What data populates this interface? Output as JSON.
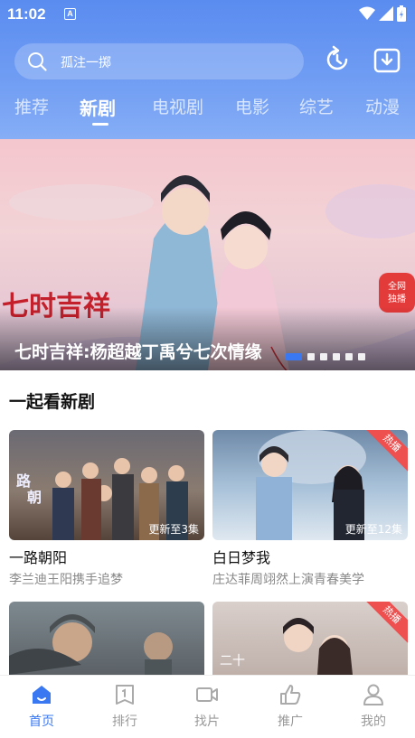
{
  "status_bar": {
    "time": "11:02",
    "notification_glyph": "A"
  },
  "search": {
    "placeholder": "孤注一掷"
  },
  "header_actions": [
    "history-icon",
    "download-icon"
  ],
  "tabs": [
    {
      "label": "推荐",
      "active": false
    },
    {
      "label": "新剧",
      "active": true
    },
    {
      "label": "电视剧",
      "active": false
    },
    {
      "label": "电影",
      "active": false
    },
    {
      "label": "综艺",
      "active": false
    },
    {
      "label": "动漫",
      "active": false
    }
  ],
  "banner": {
    "title": "七时吉祥:杨超越丁禹兮七次情缘",
    "logo_text": "七时吉祥",
    "badge_text": "全网独播",
    "slide_count": 6,
    "active_slide": 1
  },
  "section": {
    "title": "一起看新剧",
    "cards": [
      {
        "title": "一路朝阳",
        "subtitle": "李兰迪王阳携手追梦",
        "update": "更新至3集",
        "hot": false
      },
      {
        "title": "白日梦我",
        "subtitle": "庄达菲周翊然上演青春美学",
        "update": "更新至12集",
        "hot": true,
        "hot_label": "热播"
      },
      {
        "title": "",
        "subtitle": "",
        "update": "",
        "hot": false
      },
      {
        "title": "",
        "subtitle": "",
        "update": "",
        "hot": true,
        "hot_label": "热播"
      }
    ]
  },
  "bottom_nav": [
    {
      "label": "首页",
      "icon": "home-icon",
      "active": true
    },
    {
      "label": "排行",
      "icon": "ranking-icon",
      "active": false
    },
    {
      "label": "找片",
      "icon": "video-camera-icon",
      "active": false
    },
    {
      "label": "推广",
      "icon": "thumbs-up-icon",
      "active": false
    },
    {
      "label": "我的",
      "icon": "user-icon",
      "active": false
    }
  ],
  "colors": {
    "accent": "#3a78f2",
    "header_blue": "#6f9cf3",
    "hot_red": "#ee4f4f"
  }
}
